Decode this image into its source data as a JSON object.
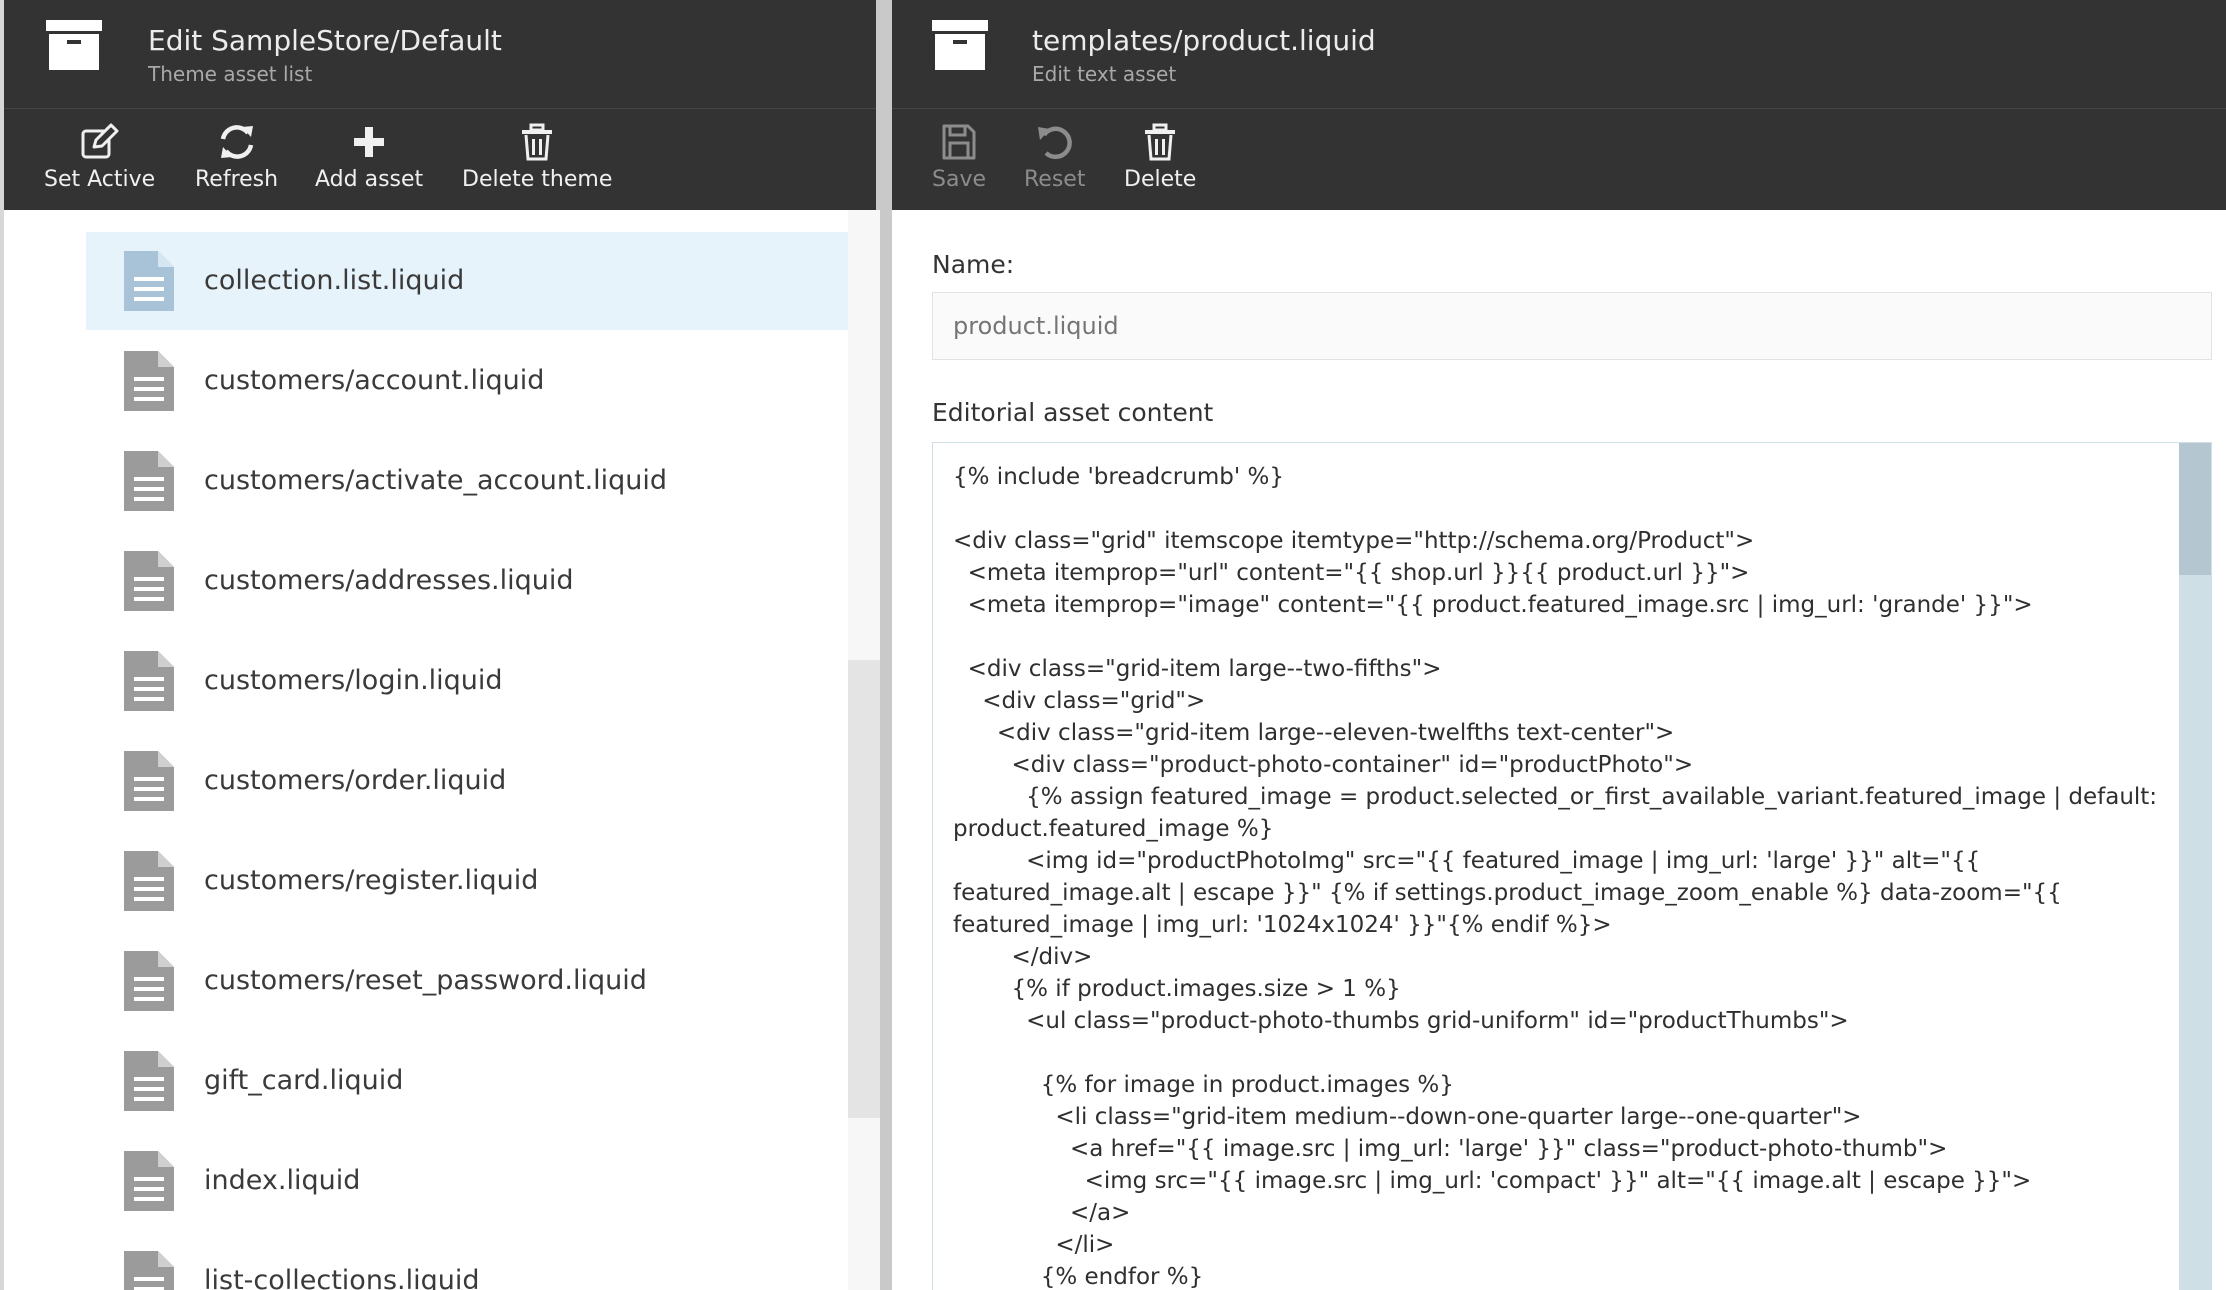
{
  "left_blade": {
    "title": "Edit SampleStore/Default",
    "subtitle": "Theme asset list",
    "toolbar": {
      "set_active": "Set Active",
      "refresh": "Refresh",
      "add_asset": "Add asset",
      "delete_theme": "Delete theme"
    },
    "assets": [
      "collection.list.liquid",
      "customers/account.liquid",
      "customers/activate_account.liquid",
      "customers/addresses.liquid",
      "customers/login.liquid",
      "customers/order.liquid",
      "customers/register.liquid",
      "customers/reset_password.liquid",
      "gift_card.liquid",
      "index.liquid",
      "list-collections.liquid"
    ]
  },
  "right_blade": {
    "title": "templates/product.liquid",
    "subtitle": "Edit text asset",
    "toolbar": {
      "save": "Save",
      "reset": "Reset",
      "delete": "Delete"
    },
    "name_label": "Name:",
    "name_placeholder": "product.liquid",
    "content_label": "Editorial asset content",
    "content": "{% include 'breadcrumb' %}\n\n<div class=\"grid\" itemscope itemtype=\"http://schema.org/Product\">\n  <meta itemprop=\"url\" content=\"{{ shop.url }}{{ product.url }}\">\n  <meta itemprop=\"image\" content=\"{{ product.featured_image.src | img_url: 'grande' }}\">\n\n  <div class=\"grid-item large--two-fifths\">\n    <div class=\"grid\">\n      <div class=\"grid-item large--eleven-twelfths text-center\">\n        <div class=\"product-photo-container\" id=\"productPhoto\">\n          {% assign featured_image = product.selected_or_first_available_variant.featured_image | default: product.featured_image %}\n          <img id=\"productPhotoImg\" src=\"{{ featured_image | img_url: 'large' }}\" alt=\"{{ featured_image.alt | escape }}\" {% if settings.product_image_zoom_enable %} data-zoom=\"{{ featured_image | img_url: '1024x1024' }}\"{% endif %}>\n        </div>\n        {% if product.images.size > 1 %}\n          <ul class=\"product-photo-thumbs grid-uniform\" id=\"productThumbs\">\n\n            {% for image in product.images %}\n              <li class=\"grid-item medium--down-one-quarter large--one-quarter\">\n                <a href=\"{{ image.src | img_url: 'large' }}\" class=\"product-photo-thumb\">\n                  <img src=\"{{ image.src | img_url: 'compact' }}\" alt=\"{{ image.alt | escape }}\">\n                </a>\n              </li>\n            {% endfor %}"
  }
}
